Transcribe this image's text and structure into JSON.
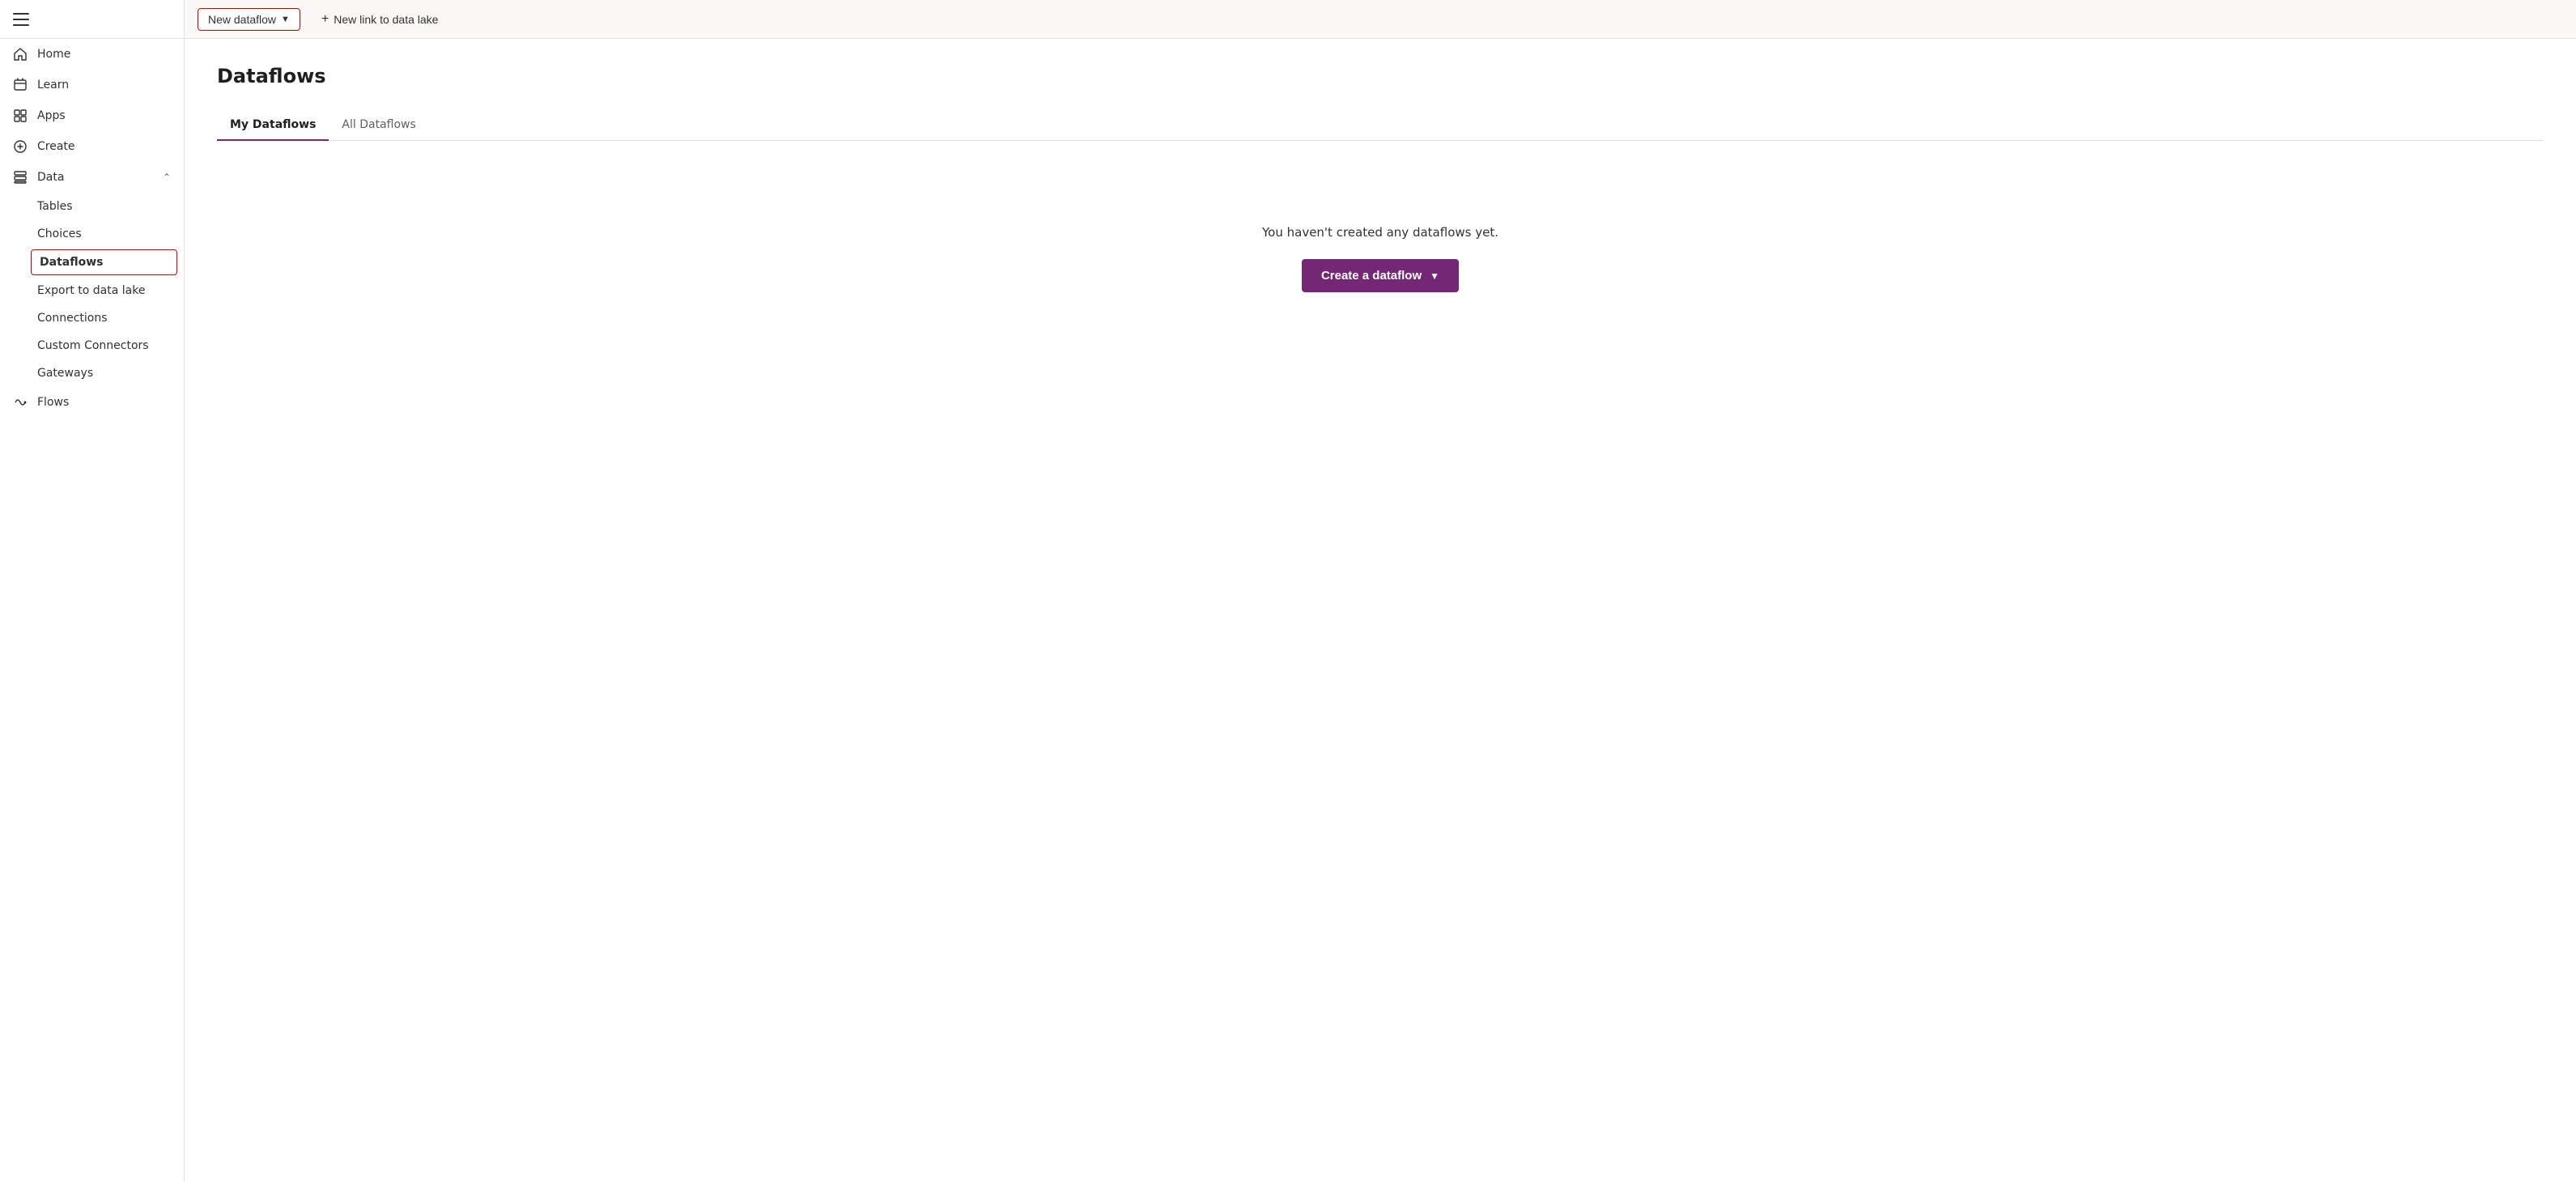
{
  "sidebar": {
    "hamburger_label": "Menu",
    "items": [
      {
        "id": "home",
        "label": "Home",
        "icon": "home-icon"
      },
      {
        "id": "learn",
        "label": "Learn",
        "icon": "learn-icon"
      },
      {
        "id": "apps",
        "label": "Apps",
        "icon": "apps-icon"
      },
      {
        "id": "create",
        "label": "Create",
        "icon": "create-icon"
      },
      {
        "id": "data",
        "label": "Data",
        "icon": "data-icon",
        "expandable": true,
        "expanded": true
      }
    ],
    "sub_items": [
      {
        "id": "tables",
        "label": "Tables"
      },
      {
        "id": "choices",
        "label": "Choices"
      },
      {
        "id": "dataflows",
        "label": "Dataflows",
        "active": true
      },
      {
        "id": "export-to-data-lake",
        "label": "Export to data lake"
      },
      {
        "id": "connections",
        "label": "Connections"
      },
      {
        "id": "custom-connectors",
        "label": "Custom Connectors"
      },
      {
        "id": "gateways",
        "label": "Gateways"
      }
    ],
    "bottom_items": [
      {
        "id": "flows",
        "label": "Flows",
        "icon": "flows-icon"
      }
    ]
  },
  "toolbar": {
    "new_dataflow_label": "New dataflow",
    "new_link_label": "New link to data lake"
  },
  "content": {
    "page_title": "Dataflows",
    "tabs": [
      {
        "id": "my-dataflows",
        "label": "My Dataflows",
        "active": true
      },
      {
        "id": "all-dataflows",
        "label": "All Dataflows",
        "active": false
      }
    ],
    "empty_state": {
      "message": "You haven't created any dataflows yet.",
      "create_button_label": "Create a dataflow"
    }
  },
  "colors": {
    "accent": "#742774",
    "active_border": "#c00",
    "tab_underline": "#742774"
  }
}
